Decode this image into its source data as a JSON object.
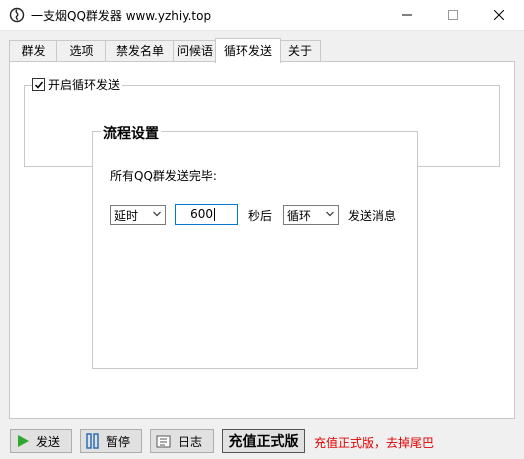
{
  "window": {
    "title": "一支烟QQ群发器 www.yzhiy.top"
  },
  "tabs": [
    {
      "label": "群发"
    },
    {
      "label": "选项"
    },
    {
      "label": "禁发名单"
    },
    {
      "label": "问候语"
    },
    {
      "label": "循环发送",
      "active": true
    },
    {
      "label": "关于"
    }
  ],
  "loop": {
    "enable_label": "开启循环发送",
    "enabled": true,
    "flow_title": "流程设置",
    "completion_label": "所有QQ群发送完毕:",
    "delay_option": "延时",
    "seconds_value": "600",
    "seconds_label": "秒后",
    "loop_option": "循环",
    "send_label": "发送消息"
  },
  "footer": {
    "send_label": "发送",
    "pause_label": "暂停",
    "log_label": "日志",
    "recharge_label": "充值正式版",
    "promo_text": "充值正式版，去掉尾巴"
  },
  "colors": {
    "promo": "#e00000",
    "focus_border": "#0078d7",
    "send_icon": "#2ea82e",
    "pause_icon": "#2b6fb6"
  },
  "icons": {
    "app": "app-swirl-icon",
    "send": "play-arrow-icon",
    "pause": "pause-bars-icon",
    "log": "log-book-icon"
  }
}
